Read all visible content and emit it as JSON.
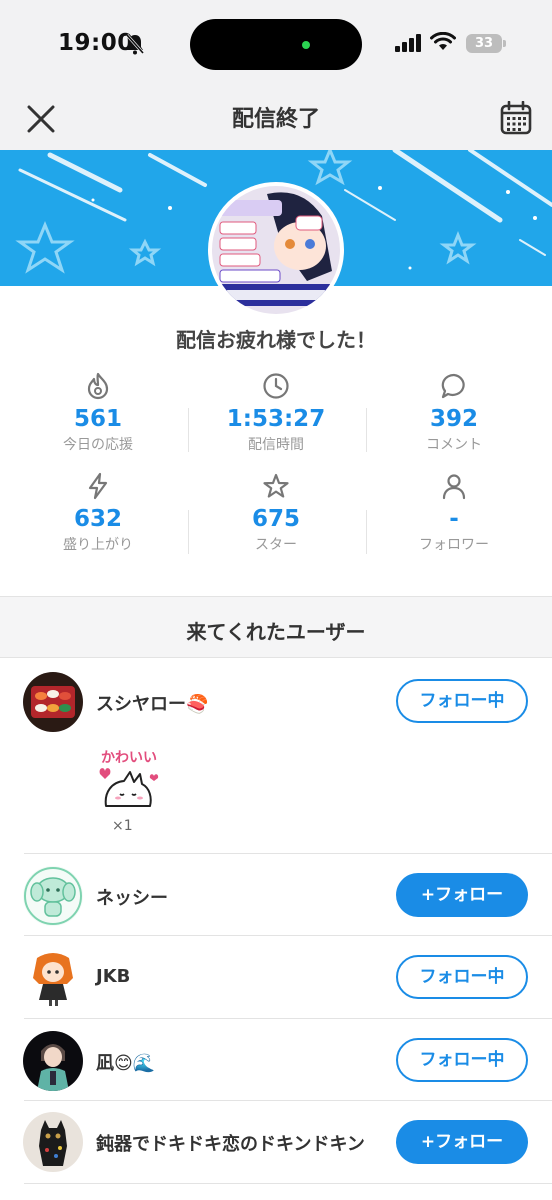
{
  "status": {
    "time": "19:00",
    "battery": "33"
  },
  "nav": {
    "title": "配信終了"
  },
  "summary": {
    "greeting": "配信お疲れ様でした！",
    "stats": [
      {
        "icon": "flame-icon",
        "value": "561",
        "label": "今日の応援"
      },
      {
        "icon": "clock-icon",
        "value": "1:53:27",
        "label": "配信時間"
      },
      {
        "icon": "comment-icon",
        "value": "392",
        "label": "コメント"
      },
      {
        "icon": "lightning-icon",
        "value": "632",
        "label": "盛り上がり"
      },
      {
        "icon": "star-icon",
        "value": "675",
        "label": "スター"
      },
      {
        "icon": "person-icon",
        "value": "-",
        "label": "フォロワー"
      }
    ]
  },
  "visitors": {
    "title": "来てくれたユーザー",
    "users": [
      {
        "name": "スシヤロー🍣",
        "button": "フォロー中",
        "following": true,
        "stamp": {
          "text": "かわいい",
          "count": "×1"
        }
      },
      {
        "name": "ネッシー",
        "button": "+フォロー",
        "following": false
      },
      {
        "name": "JKB",
        "button": "フォロー中",
        "following": true
      },
      {
        "name": "凪😊🌊",
        "button": "フォロー中",
        "following": true
      },
      {
        "name": "鈍器でドキドキ恋のドキンドキン",
        "button": "+フォロー",
        "following": false
      }
    ]
  },
  "colors": {
    "accent": "#1a8ce6",
    "banner": "#21a6ea",
    "background": "#f2f2f3"
  }
}
